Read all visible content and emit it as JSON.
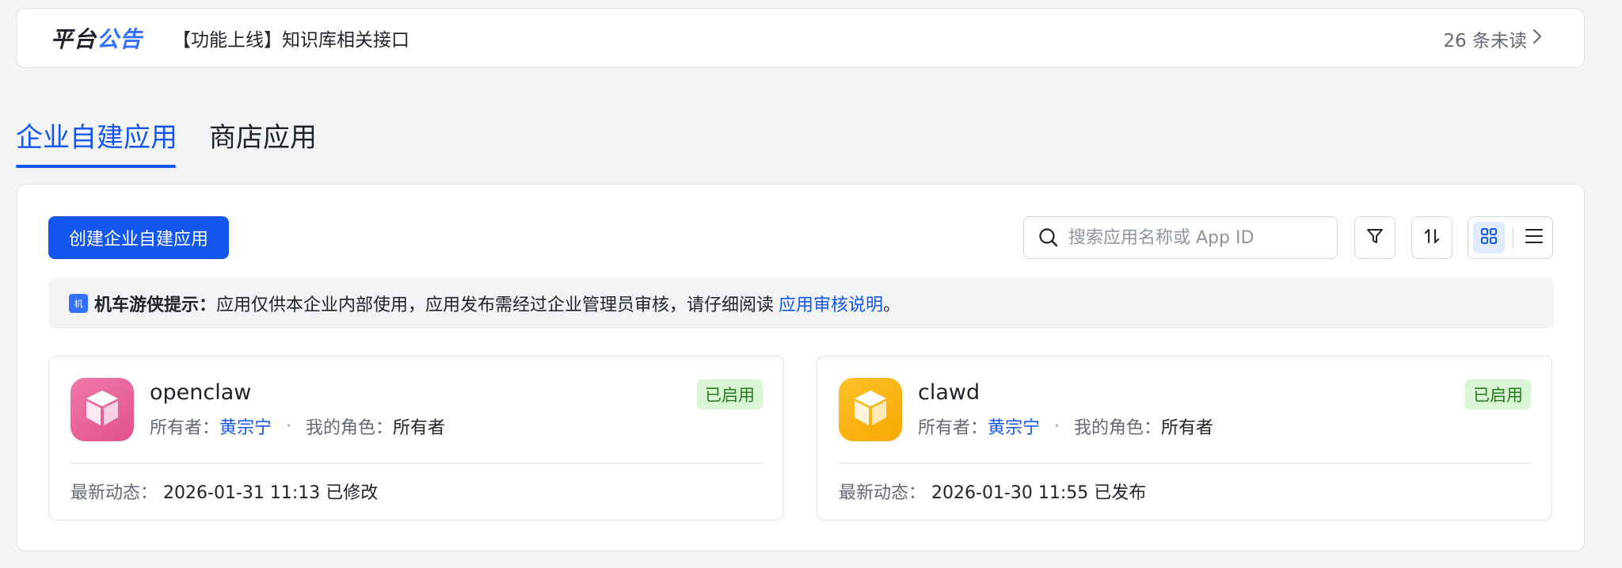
{
  "announcement": {
    "title_part1": "平台",
    "title_part2": "公告",
    "text": "【功能上线】知识库相关接口",
    "unread": "26 条未读"
  },
  "tabs": [
    {
      "label": "企业自建应用",
      "active": true
    },
    {
      "label": "商店应用",
      "active": false
    }
  ],
  "toolbar": {
    "create_label": "创建企业自建应用",
    "search_placeholder": "搜索应用名称或 App ID"
  },
  "tip": {
    "icon_text": "机",
    "label": "机车游侠提示：",
    "text": "应用仅供本企业内部使用，应用发布需经过企业管理员审核，请仔细阅读 ",
    "link": "应用审核说明",
    "end": "。"
  },
  "apps": [
    {
      "name": "openclaw",
      "owner_label": "所有者：",
      "owner": "黄宗宁",
      "separator": "·",
      "role_label": "我的角色：",
      "role": "所有者",
      "status": "已启用",
      "activity_label": "最新动态：",
      "activity": "2026-01-31 11:13 已修改",
      "icon_color": "#eb5a93",
      "icon": "cube-icon"
    },
    {
      "name": "clawd",
      "owner_label": "所有者：",
      "owner": "黄宗宁",
      "separator": "·",
      "role_label": "我的角色：",
      "role": "所有者",
      "status": "已启用",
      "activity_label": "最新动态：",
      "activity": "2026-01-30 11:55 已发布",
      "icon_color": "#fbb405",
      "icon": "cube-icon"
    }
  ],
  "colors": {
    "accent": "#1456f0",
    "enabled_badge_bg": "#d9f5d6",
    "enabled_badge_text": "#237b19"
  }
}
